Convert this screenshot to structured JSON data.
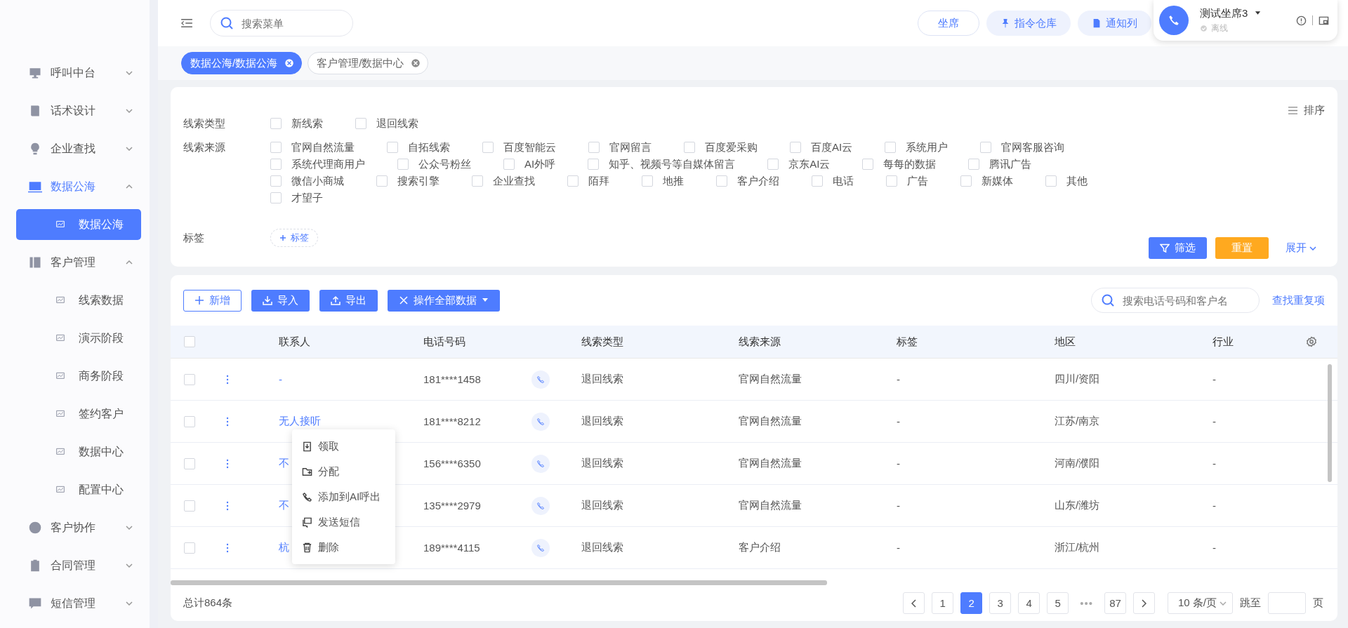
{
  "topbar": {
    "search": {
      "placeholder": "搜索菜单"
    },
    "buttons": [
      {
        "label": "坐席",
        "kind": "outline"
      },
      {
        "label": "指令仓库",
        "kind": "pin"
      },
      {
        "label": "通知列",
        "kind": "doc"
      }
    ]
  },
  "agent": {
    "name": "测试坐席3",
    "status": "离线"
  },
  "tabs": [
    {
      "label": "数据公海/数据公海",
      "selected": true
    },
    {
      "label": "客户管理/数据中心",
      "selected": false
    }
  ],
  "sidebar": {
    "items": [
      {
        "label": "呼叫中台",
        "selected": false,
        "expanded": false
      },
      {
        "label": "话术设计",
        "selected": false,
        "expanded": false
      },
      {
        "label": "企业查找",
        "selected": false,
        "expanded": false
      },
      {
        "label": "数据公海",
        "selected": true,
        "expanded": true,
        "children": [
          {
            "label": "数据公海",
            "selected": true
          }
        ]
      },
      {
        "label": "客户管理",
        "selected": false,
        "expanded": true,
        "children": [
          {
            "label": "线索数据",
            "selected": false
          },
          {
            "label": "演示阶段",
            "selected": false
          },
          {
            "label": "商务阶段",
            "selected": false
          },
          {
            "label": "签约客户",
            "selected": false
          },
          {
            "label": "数据中心",
            "selected": false
          },
          {
            "label": "配置中心",
            "selected": false
          }
        ]
      },
      {
        "label": "客户协作",
        "selected": false,
        "expanded": false
      },
      {
        "label": "合同管理",
        "selected": false,
        "expanded": false
      },
      {
        "label": "短信管理",
        "selected": false,
        "expanded": false
      }
    ]
  },
  "filters": {
    "sort": "排序",
    "groups": [
      {
        "label": "线索类型",
        "options": [
          {
            "label": "新线索",
            "checked": false
          },
          {
            "label": "退回线索",
            "checked": false
          }
        ]
      },
      {
        "label": "线索来源",
        "options": [
          {
            "label": "官网自然流量",
            "checked": false
          },
          {
            "label": "自拓线索",
            "checked": false
          },
          {
            "label": "百度智能云",
            "checked": false
          },
          {
            "label": "官网留言",
            "checked": false
          },
          {
            "label": "百度爱采购",
            "checked": false
          },
          {
            "label": "百度AI云",
            "checked": false
          },
          {
            "label": "系统用户",
            "checked": false
          },
          {
            "label": "官网客服咨询",
            "checked": false
          },
          {
            "label": "系统代理商用户",
            "checked": false
          },
          {
            "label": "公众号粉丝",
            "checked": false
          },
          {
            "label": "AI外呼",
            "checked": false
          },
          {
            "label": "知乎、视频号等自媒体留言",
            "checked": false
          },
          {
            "label": "京东AI云",
            "checked": false
          },
          {
            "label": "每每的数据",
            "checked": false
          },
          {
            "label": "腾讯广告",
            "checked": false
          },
          {
            "label": "微信小商城",
            "checked": false
          },
          {
            "label": "搜索引擎",
            "checked": false
          },
          {
            "label": "企业查找",
            "checked": false
          },
          {
            "label": "陌拜",
            "checked": false
          },
          {
            "label": "地推",
            "checked": false
          },
          {
            "label": "客户介绍",
            "checked": false
          },
          {
            "label": "电话",
            "checked": false
          },
          {
            "label": "广告",
            "checked": false
          },
          {
            "label": "新媒体",
            "checked": false
          },
          {
            "label": "其他",
            "checked": false
          },
          {
            "label": "才望子",
            "checked": false
          }
        ]
      }
    ],
    "tag": {
      "label": "标签",
      "button": "标签"
    },
    "filter_button": "筛选",
    "reset_button": "重置",
    "expand_link": "展开"
  },
  "toolbar": {
    "buttons": [
      {
        "label": "新增",
        "kind": "outline"
      },
      {
        "label": "导入",
        "kind": "import"
      },
      {
        "label": "导出",
        "kind": "export"
      },
      {
        "label": "操作全部数据",
        "kind": "menu"
      }
    ],
    "search": {
      "placeholder": "搜索电话号码和客户名"
    },
    "link": "查找重复项"
  },
  "table": {
    "all_checked": false,
    "columns": [
      "联系人",
      "电话号码",
      "线索类型",
      "线索来源",
      "标签",
      "地区",
      "行业"
    ],
    "rows": [
      {
        "checked": false,
        "contact": "-",
        "phone": "181****1458",
        "type": "退回线索",
        "source": "官网自然流量",
        "tag": "-",
        "region": "四川/资阳",
        "industry": "-"
      },
      {
        "checked": false,
        "contact": "无人接听",
        "phone": "181****8212",
        "type": "退回线索",
        "source": "官网自然流量",
        "tag": "-",
        "region": "江苏/南京",
        "industry": "-"
      },
      {
        "checked": false,
        "contact": "不",
        "phone": "156****6350",
        "type": "退回线索",
        "source": "官网自然流量",
        "tag": "-",
        "region": "河南/濮阳",
        "industry": "-"
      },
      {
        "checked": false,
        "contact": "不",
        "phone": "135****2979",
        "type": "退回线索",
        "source": "官网自然流量",
        "tag": "-",
        "region": "山东/潍坊",
        "industry": "-"
      },
      {
        "checked": false,
        "contact": "杭",
        "phone": "189****4115",
        "type": "退回线索",
        "source": "客户介绍",
        "tag": "-",
        "region": "浙江/杭州",
        "industry": "-"
      }
    ]
  },
  "context_menu": {
    "items": [
      "领取",
      "分配",
      "添加到AI呼出",
      "发送短信",
      "删除"
    ]
  },
  "footer": {
    "total": "总计864条",
    "pages": [
      {
        "label": "1",
        "kind": "page",
        "selected": false
      },
      {
        "label": "2",
        "kind": "page",
        "selected": true
      },
      {
        "label": "3",
        "kind": "page",
        "selected": false
      },
      {
        "label": "4",
        "kind": "page",
        "selected": false
      },
      {
        "label": "5",
        "kind": "page",
        "selected": false
      },
      {
        "label": "•••",
        "kind": "ellipsis",
        "selected": false
      },
      {
        "label": "87",
        "kind": "page",
        "selected": false
      }
    ],
    "page_size": "10 条/页",
    "jump": "跳至",
    "page_suffix": "页"
  }
}
